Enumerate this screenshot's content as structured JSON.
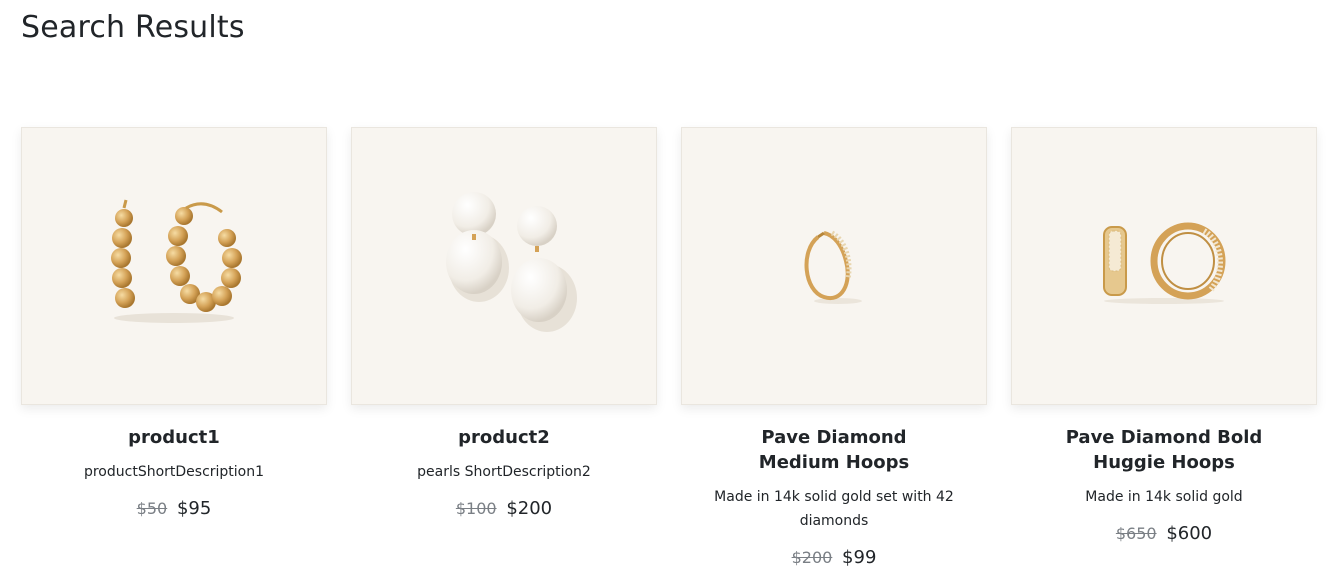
{
  "page": {
    "title": "Search Results"
  },
  "products": [
    {
      "name": "product1",
      "description": "productShortDescription1",
      "old_price": "$50",
      "price": "$95",
      "image_icon": "gold-bead-hoop-earrings-icon"
    },
    {
      "name": "product2",
      "description": "pearls ShortDescription2",
      "old_price": "$100",
      "price": "$200",
      "image_icon": "pearl-drop-earrings-icon"
    },
    {
      "name": "Pave Diamond Medium Hoops",
      "description": "Made in 14k solid gold set with 42 diamonds",
      "old_price": "$200",
      "price": "$99",
      "image_icon": "diamond-hoop-earring-icon"
    },
    {
      "name": "Pave Diamond Bold Huggie Hoops",
      "description": "Made in 14k solid gold",
      "old_price": "$650",
      "price": "$600",
      "image_icon": "diamond-huggie-earrings-icon"
    }
  ],
  "colors": {
    "image_background": "#f8f5f0",
    "gold": "#d4a257",
    "old_price": "#7a7f85"
  }
}
